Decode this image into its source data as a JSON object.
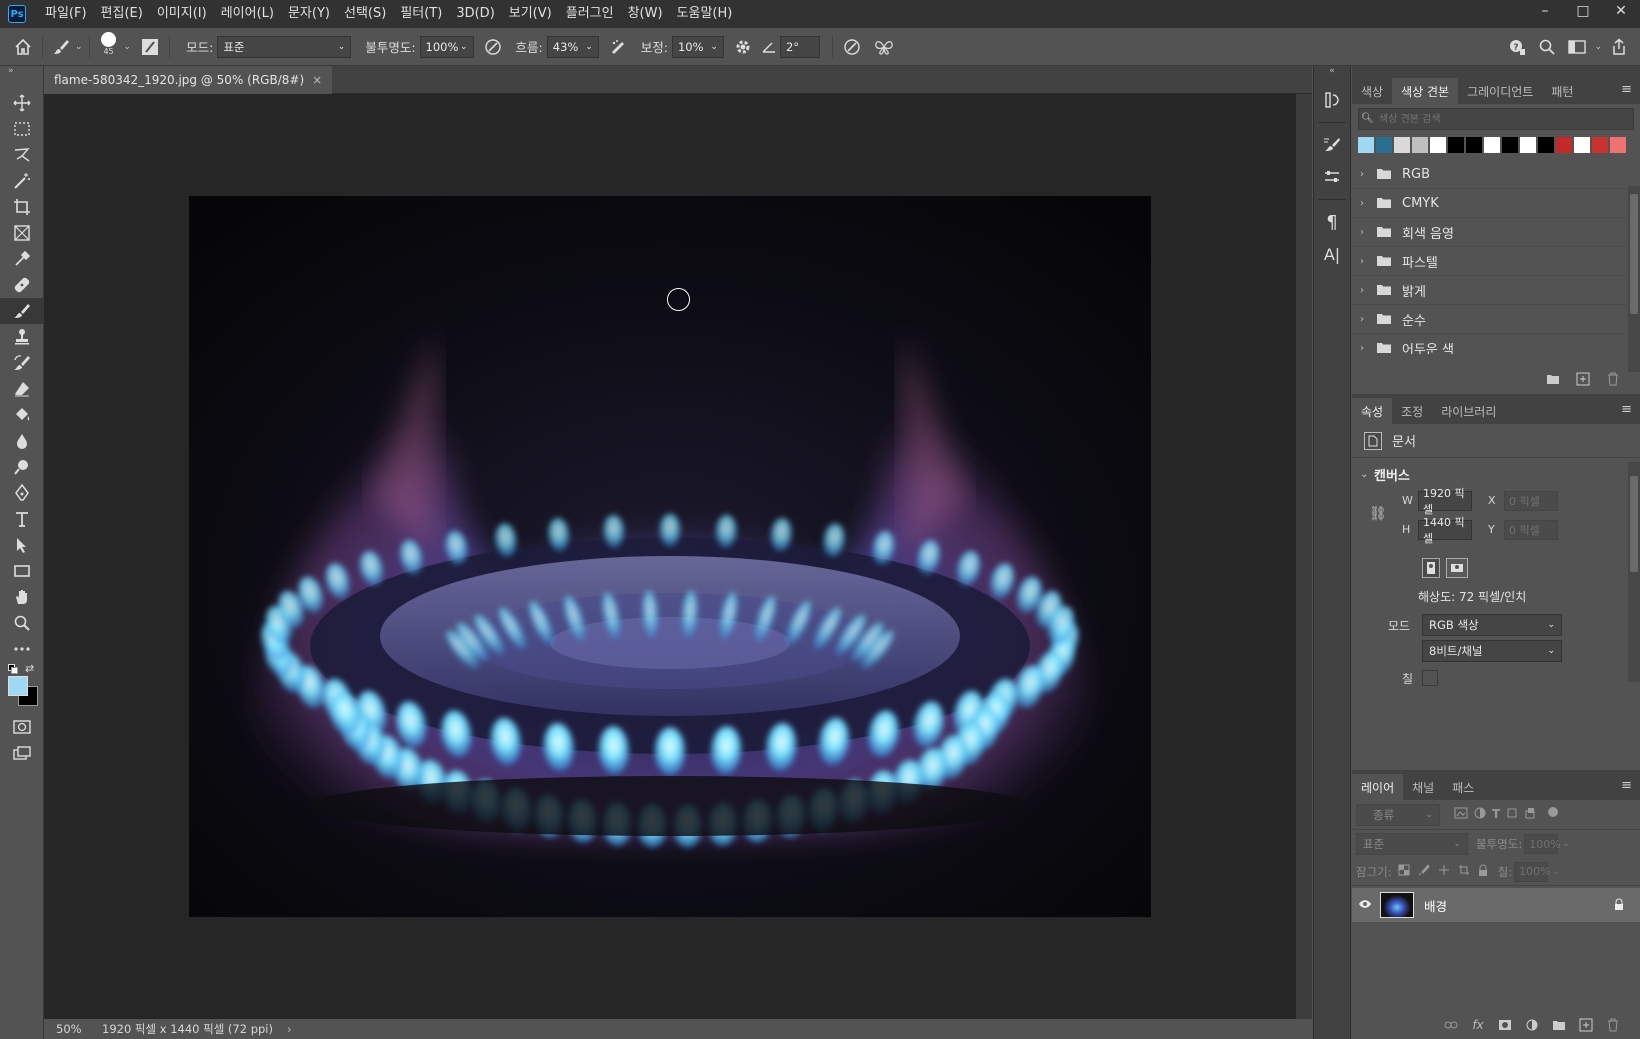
{
  "app": {
    "logo": "Ps"
  },
  "menu": [
    "파일(F)",
    "편집(E)",
    "이미지(I)",
    "레이어(L)",
    "문자(Y)",
    "선택(S)",
    "필터(T)",
    "3D(D)",
    "보기(V)",
    "플러그인",
    "창(W)",
    "도움말(H)"
  ],
  "window_controls": {
    "minimize": "–",
    "maximize": "□",
    "close": "✕"
  },
  "options": {
    "brush_size": "45",
    "mode_label": "모드:",
    "mode_value": "표준",
    "opacity_label": "불투명도:",
    "opacity_value": "100%",
    "flow_label": "흐름:",
    "flow_value": "43%",
    "smoothing_label": "보정:",
    "smoothing_value": "10%",
    "angle_value": "2°"
  },
  "document": {
    "tab_title": "flame-580342_1920.jpg @ 50% (RGB/8#)",
    "tab_close": "×",
    "zoom": "50%",
    "size_info": "1920 픽셀 x 1440 픽셀 (72 ppi)",
    "status_arrow": "›"
  },
  "swatches_panel": {
    "tabs": [
      "색상",
      "색상 견본",
      "그레이디언트",
      "패턴"
    ],
    "active_tab": 1,
    "search_placeholder": "색상 견본 검색",
    "recent_colors": [
      "#9fd8f3",
      "#2a6e91",
      "#d9d9d9",
      "#bfbfbf",
      "#ffffff",
      "#000000",
      "#000000",
      "#ffffff",
      "#000000",
      "#ffffff",
      "#000000",
      "#c22a2a",
      "#ffffff",
      "#c8322f",
      "#f07373"
    ],
    "groups": [
      "RGB",
      "CMYK",
      "회색 음영",
      "파스텔",
      "밝게",
      "순수",
      "어두운 색"
    ]
  },
  "properties_panel": {
    "tabs": [
      "속성",
      "조정",
      "라이브러리"
    ],
    "active_tab": 0,
    "doc_label": "문서",
    "section_title": "캔버스",
    "w_label": "W",
    "w_value": "1920 픽셀",
    "h_label": "H",
    "h_value": "1440 픽셀",
    "x_label": "X",
    "x_value": "0 픽셀",
    "y_label": "Y",
    "y_value": "0 픽셀",
    "resolution": "해상도: 72 픽셀/인치",
    "mode_label": "모드",
    "mode_value": "RGB 색상",
    "depth_value": "8비트/채널",
    "fill_label": "칠"
  },
  "layers_panel": {
    "tabs": [
      "레이어",
      "채널",
      "패스"
    ],
    "active_tab": 0,
    "filter_value": "종류",
    "blend_value": "표준",
    "opacity_label": "불투명도:",
    "opacity_value": "100%",
    "lock_label": "잠그기:",
    "fill_label": "칠:",
    "fill_value": "100%",
    "layers": [
      {
        "name": "배경",
        "locked": true,
        "visible": true
      }
    ]
  },
  "colors": {
    "foreground": "#9fd8f3",
    "background": "#000000"
  }
}
